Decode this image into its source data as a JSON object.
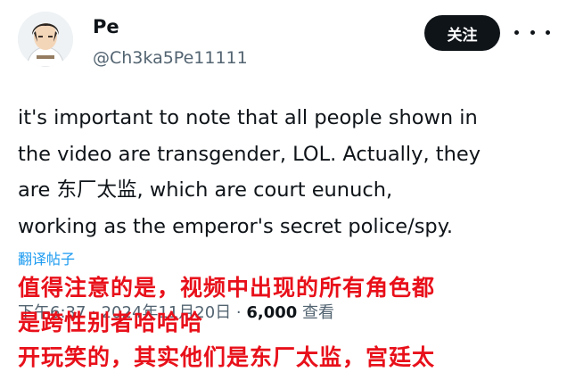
{
  "user": {
    "name": "Pe",
    "handle": "@Ch3ka5Pe11111"
  },
  "follow_label": "关注",
  "tweet": {
    "lines": [
      "it's important to note that all people shown in",
      "the video are transgender, LOL. Actually, they",
      "are 东厂太监, which are court eunuch,",
      "working as the emperor's secret police/spy."
    ]
  },
  "translate_label": "翻译帖子",
  "meta": {
    "time": "下午6:37 · 2024年11月20日 · ",
    "views_count": "6,000",
    "views_label": " 查看"
  },
  "caption": {
    "line1": "值得注意的是，视频中出现的所有角色都",
    "line2": "是跨性别者哈哈哈",
    "line3": "开玩笑的，其实他们是东厂太监，宫廷太"
  },
  "colors": {
    "caption": "#e8101a",
    "link": "#1d9bf0",
    "secondary": "#536471"
  },
  "icons": {
    "more": "three-dots-horizontal"
  }
}
